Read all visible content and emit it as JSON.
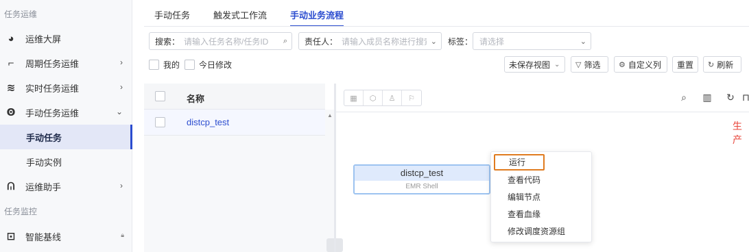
{
  "sidebar": {
    "group1": "任务运维",
    "items": [
      {
        "label": "运维大屏",
        "icon": "pie-chart-icon"
      },
      {
        "label": "周期任务运维",
        "icon": "cycle-icon"
      },
      {
        "label": "实时任务运维",
        "icon": "realtime-icon"
      },
      {
        "label": "手动任务运维",
        "icon": "manual-icon"
      }
    ],
    "subitems": [
      "手动任务",
      "手动实例"
    ],
    "assistant": "运维助手",
    "group2": "任务监控",
    "baseline": "智能基线"
  },
  "tabs": [
    "手动任务",
    "触发式工作流",
    "手动业务流程"
  ],
  "filters": {
    "search_label": "搜索：",
    "search_placeholder": "请输入任务名称/任务ID",
    "owner_label": "责任人：",
    "owner_placeholder": "请输入成员名称进行搜索",
    "tag_label": "标签：",
    "tag_placeholder": "请选择",
    "mine": "我的",
    "today_modified": "今日修改"
  },
  "toolbar": {
    "view": "未保存视图",
    "filter": "筛选",
    "custom_columns": "自定义列",
    "reset": "重置",
    "refresh": "刷新"
  },
  "table": {
    "header_name": "名称",
    "rows": [
      {
        "name": "distcp_test"
      }
    ]
  },
  "canvas": {
    "env_label": "生产",
    "node": {
      "title": "distcp_test",
      "type": "EMR Shell"
    },
    "context_menu": [
      "运行",
      "查看代码",
      "编辑节点",
      "查看血缘",
      "修改调度资源组"
    ]
  }
}
